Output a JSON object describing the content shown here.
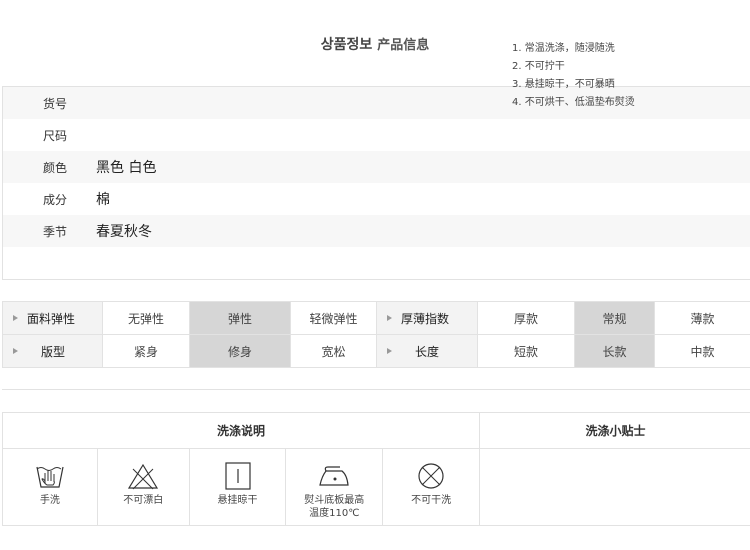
{
  "title": {
    "ko": "상품정보",
    "cn": "产品信息"
  },
  "info": [
    {
      "label": "货号",
      "value": ""
    },
    {
      "label": "尺码",
      "value": ""
    },
    {
      "label": "颜色",
      "value": "黑色 白色"
    },
    {
      "label": "成分",
      "value": "棉"
    },
    {
      "label": "季节",
      "value": "春夏秋冬"
    }
  ],
  "attributes": {
    "row1": {
      "left_label": "面料弹性",
      "left_options": [
        "无弹性",
        "弹性",
        "轻微弹性"
      ],
      "left_selected": "弹性",
      "right_label": "厚薄指数",
      "right_options": [
        "厚款",
        "常规",
        "薄款"
      ],
      "right_selected": "常规"
    },
    "row2": {
      "left_label": "版型",
      "left_options": [
        "紧身",
        "修身",
        "宽松"
      ],
      "left_selected": "修身",
      "right_label": "长度",
      "right_options": [
        "短款",
        "长款",
        "中款"
      ],
      "right_selected": "长款"
    }
  },
  "wash": {
    "instructions_title": "洗涤说明",
    "tips_title": "洗涤小贴士",
    "icons": [
      {
        "icon": "hand-wash-icon",
        "label": "手洗"
      },
      {
        "icon": "no-bleach-icon",
        "label": "不可漂白"
      },
      {
        "icon": "hang-dry-icon",
        "label": "悬挂晾干"
      },
      {
        "icon": "iron-icon",
        "label": "熨斗底板最高",
        "label2": "温度110℃"
      },
      {
        "icon": "no-dry-clean-icon",
        "label": "不可干洗"
      }
    ],
    "tips": [
      "1. 常温洗涤，随浸随洗",
      "2. 不可拧干",
      "3. 悬挂晾干，不可暴晒",
      "4. 不可烘干、低温垫布熨烫"
    ]
  }
}
